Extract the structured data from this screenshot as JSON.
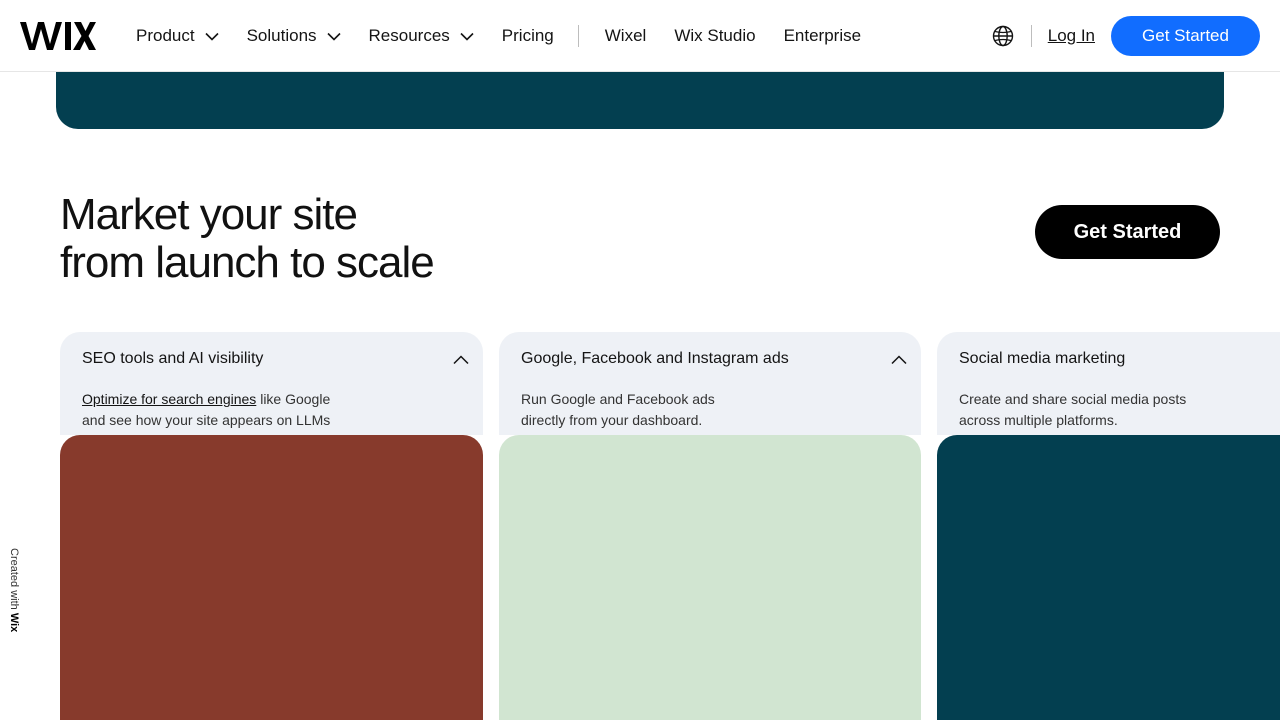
{
  "header": {
    "logo_text": "WIX",
    "nav": [
      {
        "label": "Product",
        "has_dropdown": true
      },
      {
        "label": "Solutions",
        "has_dropdown": true
      },
      {
        "label": "Resources",
        "has_dropdown": true
      },
      {
        "label": "Pricing",
        "has_dropdown": false
      }
    ],
    "nav_secondary": [
      "Wixel",
      "Wix Studio",
      "Enterprise"
    ],
    "language_icon": "globe-icon",
    "login_label": "Log In",
    "cta_label": "Get Started"
  },
  "hero": {
    "headline_line1": "Market your site",
    "headline_line2": "from launch to scale",
    "cta_label": "Get Started"
  },
  "cards": [
    {
      "title": "SEO tools and AI visibility",
      "desc_link": "Optimize for search engines",
      "desc_after_link": " like Google",
      "desc_line2": "and see how your site appears on LLMs",
      "image_color": "#873a2c"
    },
    {
      "title": "Google, Facebook and Instagram ads",
      "desc_line1": "Run Google and Facebook ads",
      "desc_line2": "directly from your dashboard.",
      "image_color": "#d1e5d1"
    },
    {
      "title": "Social media marketing",
      "desc_line1": "Create and share social media posts",
      "desc_line2": "across multiple platforms.",
      "image_color": "#033f50"
    }
  ],
  "side_label": {
    "prefix": "Created with ",
    "brand": "Wix"
  },
  "colors": {
    "brand_blue": "#116dff",
    "teal": "#033f50",
    "card_bg": "#eef1f6"
  }
}
